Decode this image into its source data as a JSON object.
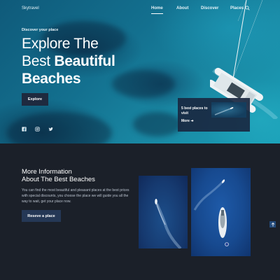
{
  "header": {
    "brand": "Skytravel",
    "nav": [
      {
        "label": "Home",
        "active": true
      },
      {
        "label": "About",
        "active": false
      },
      {
        "label": "Discover",
        "active": false
      },
      {
        "label": "Places",
        "active": false
      }
    ],
    "search_icon": "search-icon"
  },
  "hero": {
    "eyebrow": "Discover your place",
    "headline_line1": "Explore The",
    "headline_line2_regular": "Best ",
    "headline_line2_bold": "Beautiful",
    "headline_line3_bold": "Beaches",
    "explore_label": "Explore",
    "socials": [
      "facebook-icon",
      "instagram-icon",
      "twitter-icon"
    ]
  },
  "card": {
    "title": "5 best places to visit",
    "more_label": "More",
    "more_icon": "arrow-right-icon"
  },
  "info": {
    "title_line1": "More Information",
    "title_line2": "About The Best Beaches",
    "body": "You can find the most beautiful and pleasant places at the best prices with special discounts, you choose the place we will guide you all the way to wait, get your place now.",
    "reserve_label": "Reseve a place"
  },
  "colors": {
    "dark_bg": "#1b2029",
    "button_dark": "#1e2a3f",
    "button_reserve": "#253856",
    "sea": "#13708f"
  }
}
